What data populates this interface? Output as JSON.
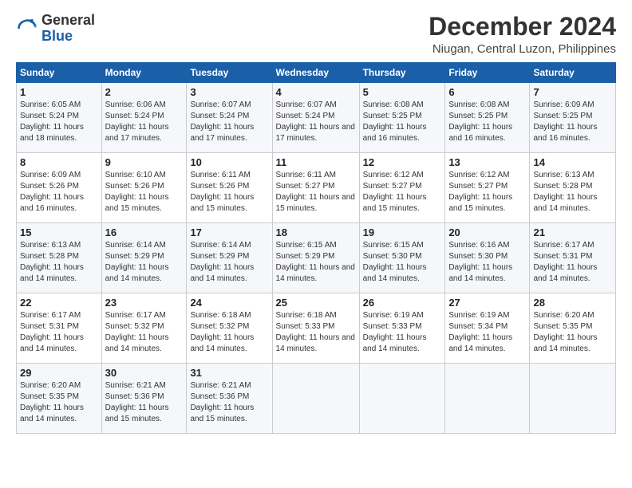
{
  "logo": {
    "general": "General",
    "blue": "Blue"
  },
  "header": {
    "month": "December 2024",
    "location": "Niugan, Central Luzon, Philippines"
  },
  "weekdays": [
    "Sunday",
    "Monday",
    "Tuesday",
    "Wednesday",
    "Thursday",
    "Friday",
    "Saturday"
  ],
  "weeks": [
    [
      {
        "day": "1",
        "sunrise": "6:05 AM",
        "sunset": "5:24 PM",
        "daylight": "11 hours and 18 minutes."
      },
      {
        "day": "2",
        "sunrise": "6:06 AM",
        "sunset": "5:24 PM",
        "daylight": "11 hours and 17 minutes."
      },
      {
        "day": "3",
        "sunrise": "6:07 AM",
        "sunset": "5:24 PM",
        "daylight": "11 hours and 17 minutes."
      },
      {
        "day": "4",
        "sunrise": "6:07 AM",
        "sunset": "5:24 PM",
        "daylight": "11 hours and 17 minutes."
      },
      {
        "day": "5",
        "sunrise": "6:08 AM",
        "sunset": "5:25 PM",
        "daylight": "11 hours and 16 minutes."
      },
      {
        "day": "6",
        "sunrise": "6:08 AM",
        "sunset": "5:25 PM",
        "daylight": "11 hours and 16 minutes."
      },
      {
        "day": "7",
        "sunrise": "6:09 AM",
        "sunset": "5:25 PM",
        "daylight": "11 hours and 16 minutes."
      }
    ],
    [
      {
        "day": "8",
        "sunrise": "6:09 AM",
        "sunset": "5:26 PM",
        "daylight": "11 hours and 16 minutes."
      },
      {
        "day": "9",
        "sunrise": "6:10 AM",
        "sunset": "5:26 PM",
        "daylight": "11 hours and 15 minutes."
      },
      {
        "day": "10",
        "sunrise": "6:11 AM",
        "sunset": "5:26 PM",
        "daylight": "11 hours and 15 minutes."
      },
      {
        "day": "11",
        "sunrise": "6:11 AM",
        "sunset": "5:27 PM",
        "daylight": "11 hours and 15 minutes."
      },
      {
        "day": "12",
        "sunrise": "6:12 AM",
        "sunset": "5:27 PM",
        "daylight": "11 hours and 15 minutes."
      },
      {
        "day": "13",
        "sunrise": "6:12 AM",
        "sunset": "5:27 PM",
        "daylight": "11 hours and 15 minutes."
      },
      {
        "day": "14",
        "sunrise": "6:13 AM",
        "sunset": "5:28 PM",
        "daylight": "11 hours and 14 minutes."
      }
    ],
    [
      {
        "day": "15",
        "sunrise": "6:13 AM",
        "sunset": "5:28 PM",
        "daylight": "11 hours and 14 minutes."
      },
      {
        "day": "16",
        "sunrise": "6:14 AM",
        "sunset": "5:29 PM",
        "daylight": "11 hours and 14 minutes."
      },
      {
        "day": "17",
        "sunrise": "6:14 AM",
        "sunset": "5:29 PM",
        "daylight": "11 hours and 14 minutes."
      },
      {
        "day": "18",
        "sunrise": "6:15 AM",
        "sunset": "5:29 PM",
        "daylight": "11 hours and 14 minutes."
      },
      {
        "day": "19",
        "sunrise": "6:15 AM",
        "sunset": "5:30 PM",
        "daylight": "11 hours and 14 minutes."
      },
      {
        "day": "20",
        "sunrise": "6:16 AM",
        "sunset": "5:30 PM",
        "daylight": "11 hours and 14 minutes."
      },
      {
        "day": "21",
        "sunrise": "6:17 AM",
        "sunset": "5:31 PM",
        "daylight": "11 hours and 14 minutes."
      }
    ],
    [
      {
        "day": "22",
        "sunrise": "6:17 AM",
        "sunset": "5:31 PM",
        "daylight": "11 hours and 14 minutes."
      },
      {
        "day": "23",
        "sunrise": "6:17 AM",
        "sunset": "5:32 PM",
        "daylight": "11 hours and 14 minutes."
      },
      {
        "day": "24",
        "sunrise": "6:18 AM",
        "sunset": "5:32 PM",
        "daylight": "11 hours and 14 minutes."
      },
      {
        "day": "25",
        "sunrise": "6:18 AM",
        "sunset": "5:33 PM",
        "daylight": "11 hours and 14 minutes."
      },
      {
        "day": "26",
        "sunrise": "6:19 AM",
        "sunset": "5:33 PM",
        "daylight": "11 hours and 14 minutes."
      },
      {
        "day": "27",
        "sunrise": "6:19 AM",
        "sunset": "5:34 PM",
        "daylight": "11 hours and 14 minutes."
      },
      {
        "day": "28",
        "sunrise": "6:20 AM",
        "sunset": "5:35 PM",
        "daylight": "11 hours and 14 minutes."
      }
    ],
    [
      {
        "day": "29",
        "sunrise": "6:20 AM",
        "sunset": "5:35 PM",
        "daylight": "11 hours and 14 minutes."
      },
      {
        "day": "30",
        "sunrise": "6:21 AM",
        "sunset": "5:36 PM",
        "daylight": "11 hours and 15 minutes."
      },
      {
        "day": "31",
        "sunrise": "6:21 AM",
        "sunset": "5:36 PM",
        "daylight": "11 hours and 15 minutes."
      },
      null,
      null,
      null,
      null
    ]
  ],
  "labels": {
    "sunrise": "Sunrise:",
    "sunset": "Sunset:",
    "daylight": "Daylight:"
  }
}
